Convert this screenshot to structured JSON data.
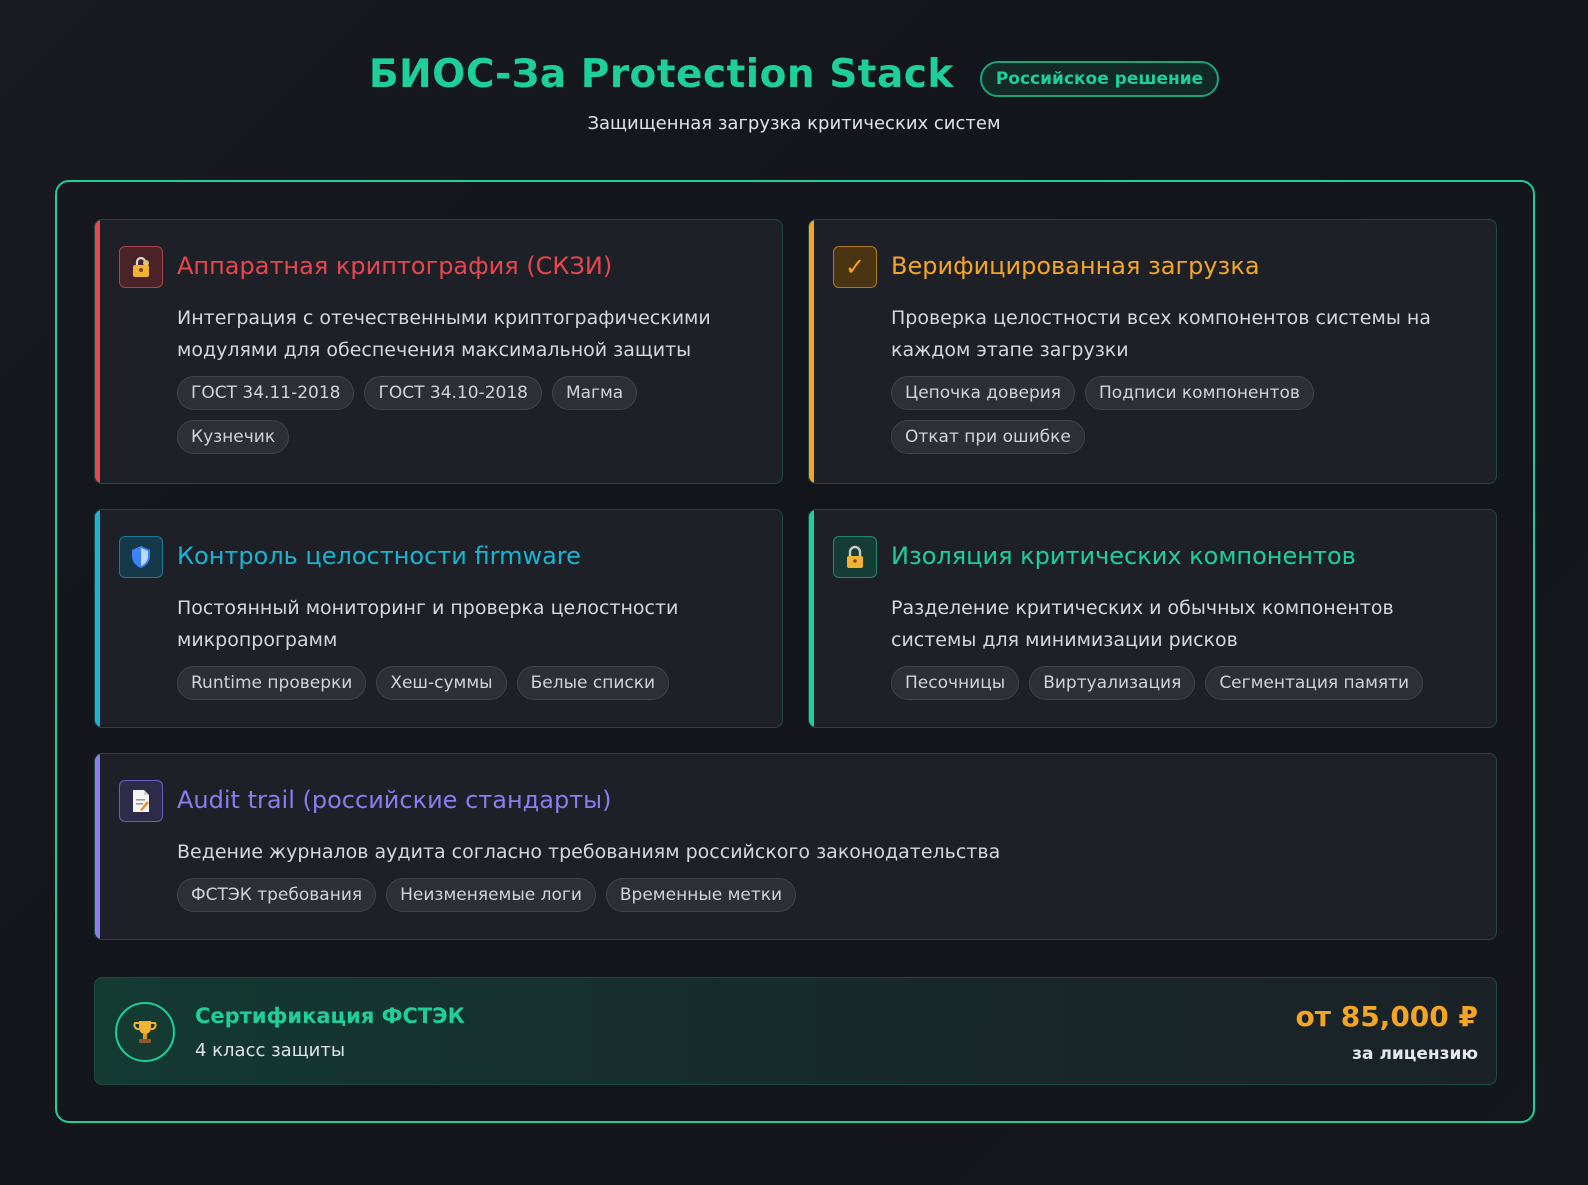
{
  "header": {
    "title": "БИОС-За Protection Stack",
    "badge": "Российское решение",
    "subtitle": "Защищенная загрузка критических систем"
  },
  "cards": [
    {
      "icon": "lock-key-icon",
      "accent": "#e8464f",
      "title": "Аппаратная криптография (СКЗИ)",
      "description": "Интеграция с отечественными криптографическими модулями для обеспечения максимальной защиты",
      "tags": [
        "ГОСТ 34.11-2018",
        "ГОСТ 34.10-2018",
        "Магма",
        "Кузнечик"
      ]
    },
    {
      "icon": "checkmark-icon",
      "accent": "#f5a524",
      "title": "Верифицированная загрузка",
      "description": "Проверка целостности всех компонентов системы на каждом этапе загрузки",
      "tags": [
        "Цепочка доверия",
        "Подписи компонентов",
        "Откат при ошибке"
      ]
    },
    {
      "icon": "shield-icon",
      "accent": "#1ab3d1",
      "title": "Контроль целостности firmware",
      "description": "Постоянный мониторинг и проверка целостности микропрограмм",
      "tags": [
        "Runtime проверки",
        "Хеш-суммы",
        "Белые списки"
      ]
    },
    {
      "icon": "padlock-icon",
      "accent": "#1ecf9a",
      "title": "Изоляция критических компонентов",
      "description": "Разделение критических и обычных компонентов системы для минимизации рисков",
      "tags": [
        "Песочницы",
        "Виртуализация",
        "Сегментация памяти"
      ]
    },
    {
      "icon": "document-icon",
      "accent": "#8b7cf0",
      "title": "Audit trail (российские стандарты)",
      "description": "Ведение журналов аудита согласно требованиям российского законодательства",
      "tags": [
        "ФСТЭК требования",
        "Неизменяемые логи",
        "Временные метки"
      ]
    }
  ],
  "certification": {
    "icon": "trophy-icon",
    "title": "Сертификация ФСТЭК",
    "subtitle": "4 класс защиты",
    "price": "от 85,000 ₽",
    "price_note": "за лицензию"
  }
}
